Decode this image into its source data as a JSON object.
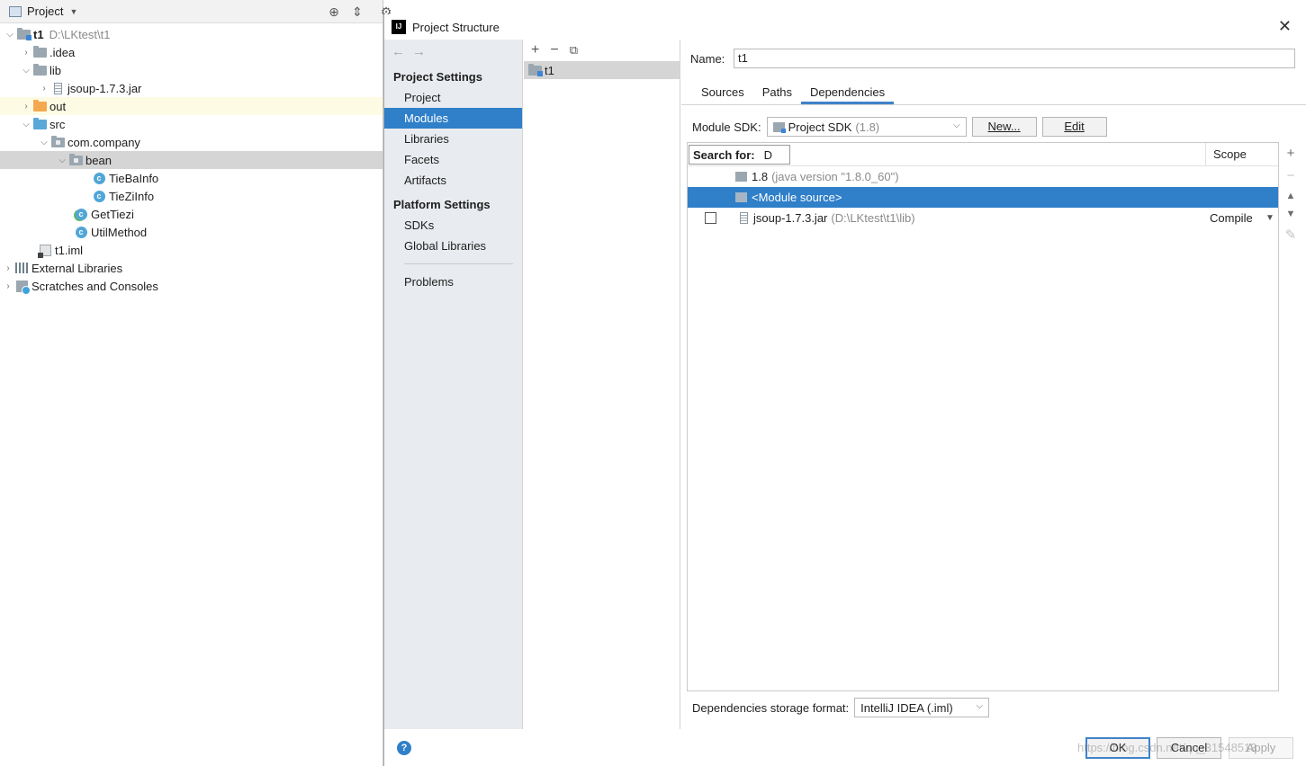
{
  "project_panel": {
    "title": "Project",
    "tree": [
      {
        "label": "t1",
        "hint": "D:\\LKtest\\t1",
        "depth": 0,
        "expanded": true,
        "icon": "module-folder-icon"
      },
      {
        "label": ".idea",
        "depth": 1,
        "expanded": false,
        "icon": "folder-icon"
      },
      {
        "label": "lib",
        "depth": 1,
        "expanded": true,
        "icon": "folder-icon"
      },
      {
        "label": "jsoup-1.7.3.jar",
        "depth": 2,
        "expanded": false,
        "icon": "jar-icon"
      },
      {
        "label": "out",
        "depth": 1,
        "expanded": false,
        "icon": "excluded-folder-icon"
      },
      {
        "label": "src",
        "depth": 1,
        "expanded": true,
        "icon": "source-folder-icon"
      },
      {
        "label": "com.company",
        "depth": 2,
        "expanded": true,
        "icon": "package-icon"
      },
      {
        "label": "bean",
        "depth": 3,
        "expanded": true,
        "icon": "package-icon"
      },
      {
        "label": "TieBaInfo",
        "depth": 4,
        "icon": "class-icon"
      },
      {
        "label": "TieZiInfo",
        "depth": 4,
        "icon": "class-icon"
      },
      {
        "label": "GetTiezi",
        "depth": 3,
        "icon": "main-class-icon"
      },
      {
        "label": "UtilMethod",
        "depth": 3,
        "icon": "class-icon"
      },
      {
        "label": "t1.iml",
        "depth": 2,
        "icon": "iml-file-icon"
      },
      {
        "label": "External Libraries",
        "depth": 0,
        "expanded": false,
        "icon": "libraries-icon"
      },
      {
        "label": "Scratches and Consoles",
        "depth": 0,
        "expanded": false,
        "icon": "scratches-icon"
      }
    ]
  },
  "dialog": {
    "title": "Project Structure",
    "nav": {
      "project_settings_header": "Project Settings",
      "project_settings": [
        "Project",
        "Modules",
        "Libraries",
        "Facets",
        "Artifacts"
      ],
      "platform_settings_header": "Platform Settings",
      "platform_settings": [
        "SDKs",
        "Global Libraries"
      ],
      "problems": "Problems",
      "selected": "Modules"
    },
    "modules": [
      "t1"
    ],
    "details": {
      "name_label": "Name:",
      "name_value": "t1",
      "tabs": [
        "Sources",
        "Paths",
        "Dependencies"
      ],
      "active_tab": "Dependencies",
      "module_sdk_label": "Module SDK:",
      "module_sdk_value": "Project SDK",
      "module_sdk_version": "(1.8)",
      "new_button": "New...",
      "edit_button": "Edit",
      "search_label": "Search for:",
      "search_value": "D",
      "scope_header": "Scope",
      "dependencies": [
        {
          "name": "1.8",
          "detail": "(java version \"1.8.0_60\")",
          "checkbox": false,
          "scope": ""
        },
        {
          "name": "<Module source>",
          "detail": "",
          "checkbox": false,
          "scope": "",
          "selected": true
        },
        {
          "name": "jsoup-1.7.3.jar",
          "detail": "(D:\\LKtest\\t1\\lib)",
          "checkbox": true,
          "checked": false,
          "scope": "Compile"
        }
      ],
      "storage_format_label": "Dependencies storage format:",
      "storage_format_value": "IntelliJ IDEA (.iml)"
    },
    "footer": {
      "ok": "OK",
      "cancel": "Cancel",
      "apply": "Apply",
      "watermark": "https://blog.csdn.net/qq_31548513"
    }
  },
  "colors": {
    "selection": "#2f7fc9",
    "accent": "#4083c9"
  }
}
